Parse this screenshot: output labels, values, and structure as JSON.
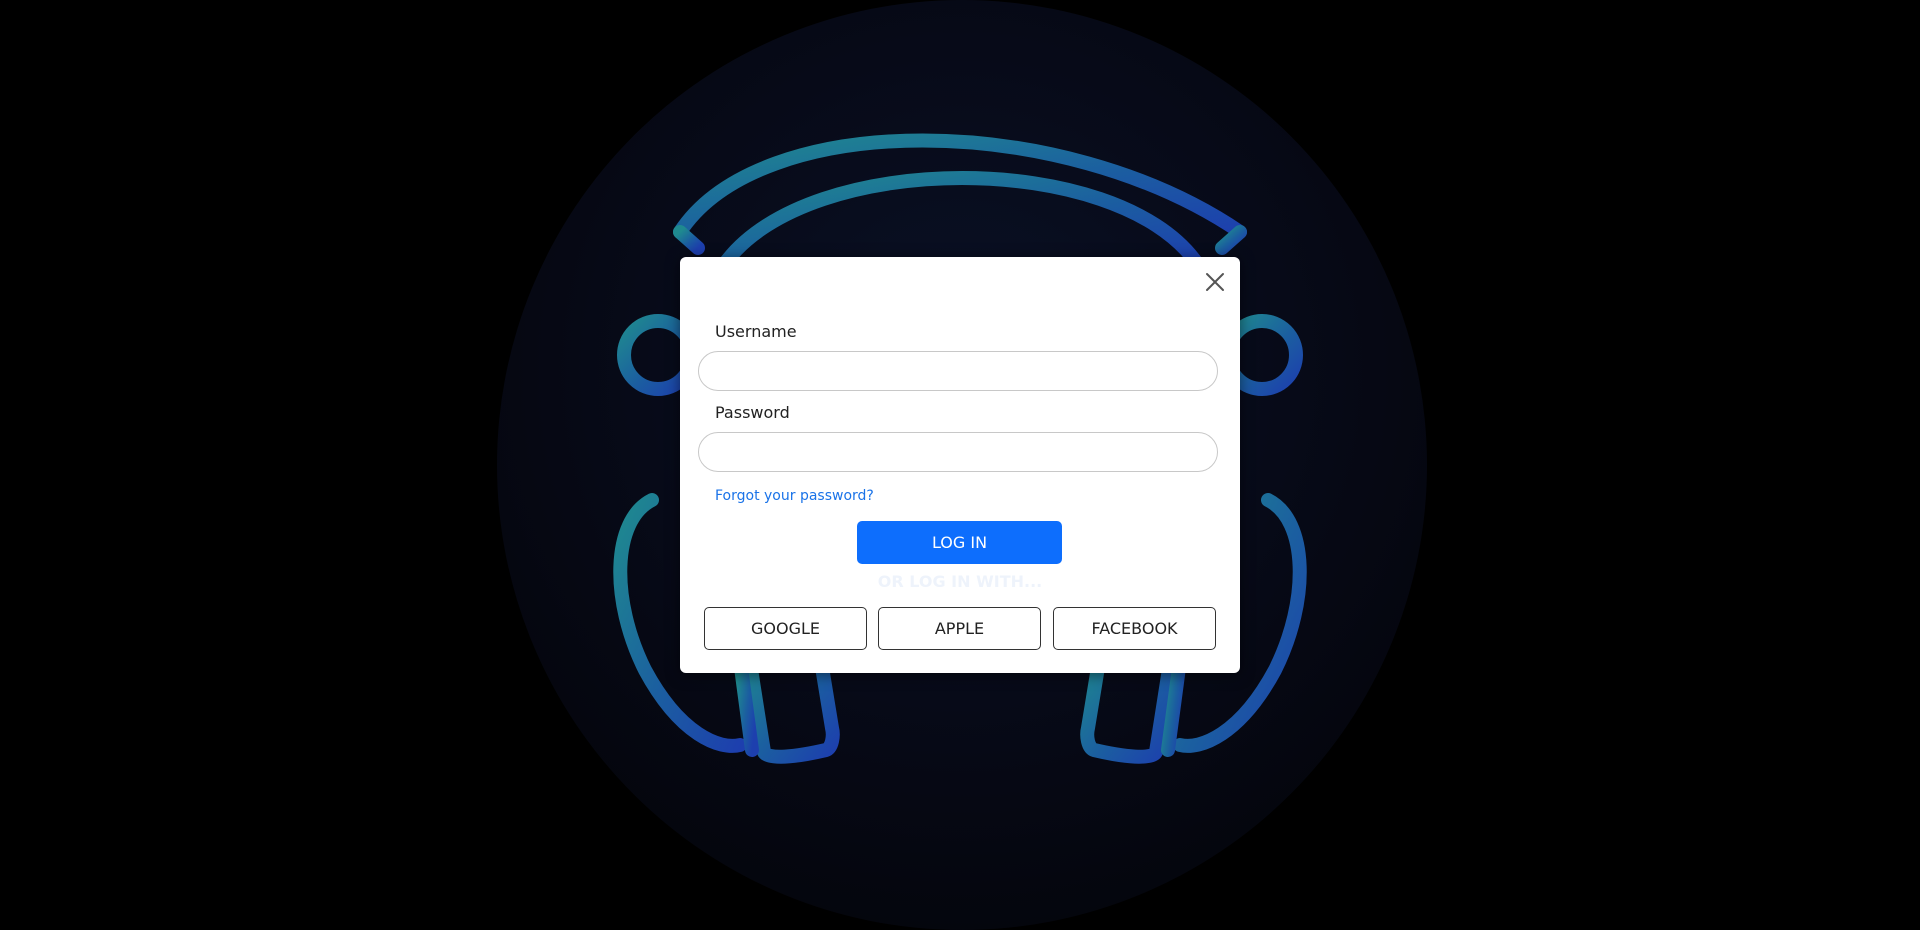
{
  "login_form": {
    "username_label": "Username",
    "username_value": "",
    "password_label": "Password",
    "password_value": "",
    "forgot_password_link": "Forgot your password?",
    "login_button": "LOG IN",
    "divider_text": "OR LOG IN WITH...",
    "social_buttons": [
      "GOOGLE",
      "APPLE",
      "FACEBOOK"
    ]
  },
  "icons": {
    "close": "close-icon",
    "background_logo": "headphones-logo"
  },
  "colors": {
    "page_background": "#000000",
    "primary_button": "#0d6efd",
    "link": "#1a73e8",
    "logo_gradient_start": "#1f8a8f",
    "logo_gradient_end": "#1d3fae"
  }
}
